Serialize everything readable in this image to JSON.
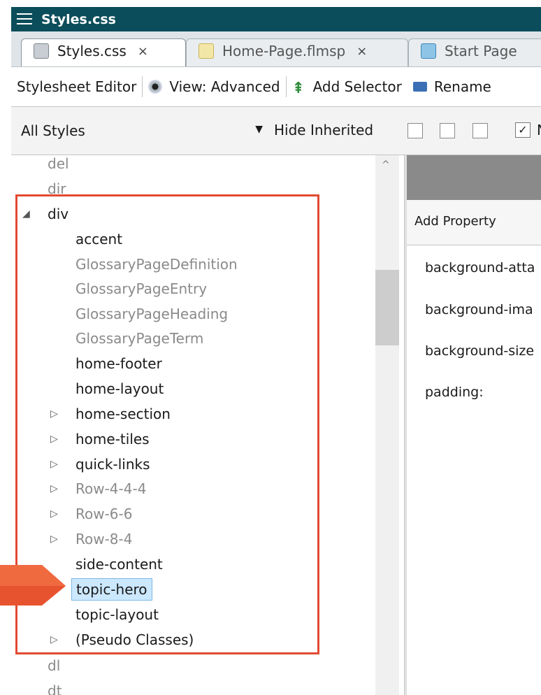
{
  "window": {
    "title": "Styles.css"
  },
  "tabs": [
    {
      "label": "Styles.css",
      "active": true,
      "icon": "css-file-icon"
    },
    {
      "label": "Home-Page.flmsp",
      "active": false,
      "icon": "page-file-icon"
    },
    {
      "label": "Start Page",
      "active": false,
      "icon": "start-page-icon"
    }
  ],
  "tab_close_glyph": "×",
  "toolbar": {
    "editor_label": "Stylesheet Editor",
    "view_label": "View: Advanced",
    "add_selector_label": "Add Selector",
    "rename_label": "Rename"
  },
  "filter": {
    "select_value": "All Styles",
    "hide_inherited_label": "Hide Inherited",
    "checkbox_label": "N"
  },
  "tree": {
    "items": [
      {
        "label": "del",
        "inherited": true,
        "expander": ""
      },
      {
        "label": "dir",
        "inherited": true,
        "expander": ""
      },
      {
        "label": "div",
        "inherited": false,
        "expander": "◢"
      },
      {
        "label": "accent",
        "inherited": false,
        "expander": ""
      },
      {
        "label": "GlossaryPageDefinition",
        "inherited": true,
        "expander": ""
      },
      {
        "label": "GlossaryPageEntry",
        "inherited": true,
        "expander": ""
      },
      {
        "label": "GlossaryPageHeading",
        "inherited": true,
        "expander": ""
      },
      {
        "label": "GlossaryPageTerm",
        "inherited": true,
        "expander": ""
      },
      {
        "label": "home-footer",
        "inherited": false,
        "expander": ""
      },
      {
        "label": "home-layout",
        "inherited": false,
        "expander": ""
      },
      {
        "label": "home-section",
        "inherited": false,
        "expander": "▷"
      },
      {
        "label": "home-tiles",
        "inherited": false,
        "expander": "▷"
      },
      {
        "label": "quick-links",
        "inherited": false,
        "expander": "▷"
      },
      {
        "label": "Row-4-4-4",
        "inherited": true,
        "expander": "▷"
      },
      {
        "label": "Row-6-6",
        "inherited": true,
        "expander": "▷"
      },
      {
        "label": "Row-8-4",
        "inherited": true,
        "expander": "▷"
      },
      {
        "label": "side-content",
        "inherited": false,
        "expander": ""
      },
      {
        "label": "topic-hero",
        "inherited": false,
        "expander": "",
        "selected": true
      },
      {
        "label": "topic-layout",
        "inherited": false,
        "expander": ""
      },
      {
        "label": "(Pseudo Classes)",
        "inherited": false,
        "expander": "▷"
      },
      {
        "label": "dl",
        "inherited": true,
        "expander": ""
      },
      {
        "label": "dt",
        "inherited": true,
        "expander": ""
      }
    ]
  },
  "properties": {
    "add_property_label": "Add Property",
    "items": [
      "background-atta",
      "background-ima",
      "background-size",
      "padding:"
    ]
  },
  "colors": {
    "titlebar": "#0b4d5a",
    "highlight": "#e24a33",
    "selection": "#cce8ff"
  }
}
